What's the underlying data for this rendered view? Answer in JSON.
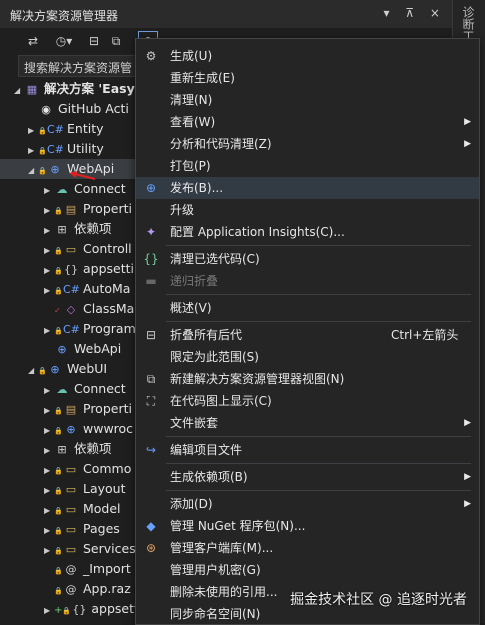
{
  "window": {
    "title": "解决方案资源管理器",
    "controls": "▾ ⊼ ×"
  },
  "side_strip": {
    "text": "诊断工"
  },
  "search": {
    "text": "搜索解决方案资源管"
  },
  "tree": [
    {
      "name": "tree-solution",
      "indent": 0,
      "arrow": "◢",
      "icon": "▦",
      "icon_color": "#9b8bd6",
      "label": "解决方案 'Easy",
      "bold": true
    },
    {
      "name": "tree-github",
      "indent": 1,
      "arrow": "",
      "icon": "◉",
      "icon_color": "#e6e6e6",
      "label": "GitHub Acti"
    },
    {
      "name": "tree-entity",
      "indent": 1,
      "arrow": "▶",
      "lock": "🔒",
      "icon": "C#",
      "icon_color": "#68a0ff",
      "label": "Entity"
    },
    {
      "name": "tree-utility",
      "indent": 1,
      "arrow": "▶",
      "lock": "🔒",
      "icon": "C#",
      "icon_color": "#68a0ff",
      "label": "Utility"
    },
    {
      "name": "tree-webapi",
      "indent": 1,
      "arrow": "◢",
      "lock": "🔒",
      "icon": "⊕",
      "icon_color": "#68a0ff",
      "label": "WebApi",
      "selected": true
    },
    {
      "name": "tree-webapi-connected",
      "indent": 2,
      "arrow": "▶",
      "icon": "☁",
      "icon_color": "#69c0b0",
      "label": "Connect"
    },
    {
      "name": "tree-webapi-properties",
      "indent": 2,
      "arrow": "▶",
      "lock": "🔒",
      "icon": "▤",
      "icon_color": "#c8a060",
      "label": "Properti"
    },
    {
      "name": "tree-webapi-deps",
      "indent": 2,
      "arrow": "▶",
      "icon": "⊞",
      "icon_color": "#cfcfcf",
      "label": "依赖项"
    },
    {
      "name": "tree-webapi-controllers",
      "indent": 2,
      "arrow": "▶",
      "lock": "🔒",
      "icon": "▭",
      "icon_color": "#dcb862",
      "label": "Controll"
    },
    {
      "name": "tree-webapi-appsettings",
      "indent": 2,
      "arrow": "▶",
      "lock": "🔒",
      "icon": "{}",
      "icon_color": "#cfcfcf",
      "label": "appsetti"
    },
    {
      "name": "tree-webapi-automapper",
      "indent": 2,
      "arrow": "▶",
      "lock": "🔒",
      "icon": "C#",
      "icon_color": "#68a0ff",
      "label": "AutoMa"
    },
    {
      "name": "tree-webapi-classmap",
      "indent": 2,
      "arrow": "",
      "check": "✓",
      "icon": "◇",
      "icon_color": "#b070d0",
      "label": "ClassMa"
    },
    {
      "name": "tree-webapi-program",
      "indent": 2,
      "arrow": "▶",
      "lock": "🔒",
      "icon": "C#",
      "icon_color": "#68a0ff",
      "label": "Program"
    },
    {
      "name": "tree-webapi-http",
      "indent": 2,
      "arrow": "",
      "icon": "⊕",
      "icon_color": "#68a0ff",
      "label": "WebApi"
    },
    {
      "name": "tree-webui",
      "indent": 1,
      "arrow": "◢",
      "lock": "🔒",
      "icon": "⊕",
      "icon_color": "#68a0ff",
      "label": "WebUI"
    },
    {
      "name": "tree-webui-connected",
      "indent": 2,
      "arrow": "▶",
      "icon": "☁",
      "icon_color": "#69c0b0",
      "label": "Connect"
    },
    {
      "name": "tree-webui-properties",
      "indent": 2,
      "arrow": "▶",
      "lock": "🔒",
      "icon": "▤",
      "icon_color": "#c8a060",
      "label": "Properti"
    },
    {
      "name": "tree-webui-wwwroot",
      "indent": 2,
      "arrow": "▶",
      "lock": "🔒",
      "icon": "⊕",
      "icon_color": "#68a0ff",
      "label": "wwwroc"
    },
    {
      "name": "tree-webui-deps",
      "indent": 2,
      "arrow": "▶",
      "icon": "⊞",
      "icon_color": "#cfcfcf",
      "label": "依赖项"
    },
    {
      "name": "tree-webui-common",
      "indent": 2,
      "arrow": "▶",
      "lock": "🔒",
      "icon": "▭",
      "icon_color": "#dcb862",
      "label": "Commo"
    },
    {
      "name": "tree-webui-layout",
      "indent": 2,
      "arrow": "▶",
      "lock": "🔒",
      "icon": "▭",
      "icon_color": "#dcb862",
      "label": "Layout"
    },
    {
      "name": "tree-webui-model",
      "indent": 2,
      "arrow": "▶",
      "lock": "🔒",
      "icon": "▭",
      "icon_color": "#dcb862",
      "label": "Model"
    },
    {
      "name": "tree-webui-pages",
      "indent": 2,
      "arrow": "▶",
      "lock": "🔒",
      "icon": "▭",
      "icon_color": "#dcb862",
      "label": "Pages"
    },
    {
      "name": "tree-webui-services",
      "indent": 2,
      "arrow": "▶",
      "lock": "🔒",
      "icon": "▭",
      "icon_color": "#dcb862",
      "label": "Services"
    },
    {
      "name": "tree-webui-imports",
      "indent": 2,
      "arrow": "",
      "lock": "🔒",
      "icon": "@",
      "icon_color": "#cfcfcf",
      "label": "_Import"
    },
    {
      "name": "tree-webui-app",
      "indent": 2,
      "arrow": "",
      "lock": "🔒",
      "icon": "@",
      "icon_color": "#cfcfcf",
      "label": "App.raz"
    },
    {
      "name": "tree-webui-appsettings",
      "indent": 2,
      "arrow": "▶",
      "plus": "+",
      "lock": "🔒",
      "icon": "{}",
      "icon_color": "#cfcfcf",
      "label": "appsetti"
    }
  ],
  "menu": [
    {
      "type": "item",
      "name": "menu-build",
      "icon": "⚙",
      "icon_name": "build-icon",
      "label": "生成(U)"
    },
    {
      "type": "item",
      "name": "menu-rebuild",
      "icon": "",
      "label": "重新生成(E)"
    },
    {
      "type": "item",
      "name": "menu-clean",
      "icon": "",
      "label": "清理(N)"
    },
    {
      "type": "item",
      "name": "menu-view",
      "icon": "",
      "label": "查看(W)",
      "submenu": true
    },
    {
      "type": "item",
      "name": "menu-analyze",
      "icon": "",
      "label": "分析和代码清理(Z)",
      "submenu": true
    },
    {
      "type": "item",
      "name": "menu-pack",
      "icon": "",
      "label": "打包(P)"
    },
    {
      "type": "item",
      "name": "menu-publish",
      "icon": "⊕",
      "icon_name": "globe-icon",
      "label": "发布(B)...",
      "highlight": true
    },
    {
      "type": "item",
      "name": "menu-upgrade",
      "icon": "",
      "label": "升级"
    },
    {
      "type": "item",
      "name": "menu-app-insights",
      "icon": "✦",
      "icon_name": "app-insights-icon",
      "label": "配置 Application Insights(C)..."
    },
    {
      "type": "sep"
    },
    {
      "type": "item",
      "name": "menu-clean-code",
      "icon": "{}",
      "icon_name": "braces-icon",
      "label": "清理已选代码(C)"
    },
    {
      "type": "item",
      "name": "menu-collapse-recursive",
      "icon": "▬",
      "icon_name": "collapse-icon",
      "label": "递归折叠",
      "disabled": true
    },
    {
      "type": "sep"
    },
    {
      "type": "item",
      "name": "menu-overview",
      "icon": "",
      "label": "概述(V)"
    },
    {
      "type": "sep"
    },
    {
      "type": "item",
      "name": "menu-collapse-all",
      "icon": "⊟",
      "icon_name": "collapse-all-icon",
      "label": "折叠所有后代",
      "shortcut": "Ctrl+左箭头"
    },
    {
      "type": "item",
      "name": "menu-scope",
      "icon": "",
      "label": "限定为此范围(S)"
    },
    {
      "type": "item",
      "name": "menu-new-view",
      "icon": "⧉",
      "icon_name": "new-view-icon",
      "label": "新建解决方案资源管理器视图(N)"
    },
    {
      "type": "item",
      "name": "menu-code-map",
      "icon": "⛶",
      "icon_name": "code-map-icon",
      "label": "在代码图上显示(C)"
    },
    {
      "type": "item",
      "name": "menu-file-nesting",
      "icon": "",
      "label": "文件嵌套",
      "submenu": true
    },
    {
      "type": "sep"
    },
    {
      "type": "item",
      "name": "menu-edit-project",
      "icon": "↪",
      "icon_name": "edit-project-icon",
      "label": "编辑项目文件"
    },
    {
      "type": "sep"
    },
    {
      "type": "item",
      "name": "menu-build-deps",
      "icon": "",
      "label": "生成依赖项(B)",
      "submenu": true
    },
    {
      "type": "sep"
    },
    {
      "type": "item",
      "name": "menu-add",
      "icon": "",
      "label": "添加(D)",
      "submenu": true
    },
    {
      "type": "item",
      "name": "menu-nuget",
      "icon": "◆",
      "icon_name": "nuget-icon",
      "label": "管理 NuGet 程序包(N)..."
    },
    {
      "type": "item",
      "name": "menu-client-libs",
      "icon": "⊛",
      "icon_name": "client-libs-icon",
      "label": "管理客户端库(M)..."
    },
    {
      "type": "item",
      "name": "menu-user-secrets",
      "icon": "",
      "label": "管理用户机密(G)"
    },
    {
      "type": "item",
      "name": "menu-remove-refs",
      "icon": "",
      "label": "删除未使用的引用..."
    },
    {
      "type": "item",
      "name": "menu-sync-ns",
      "icon": "",
      "label": "同步命名空间(N)"
    }
  ],
  "watermark": "掘金技术社区 @ 追逐时光者",
  "colors": {
    "accent": "#68a0ff",
    "highlight": "#323a44",
    "arrow": "#e02020"
  }
}
